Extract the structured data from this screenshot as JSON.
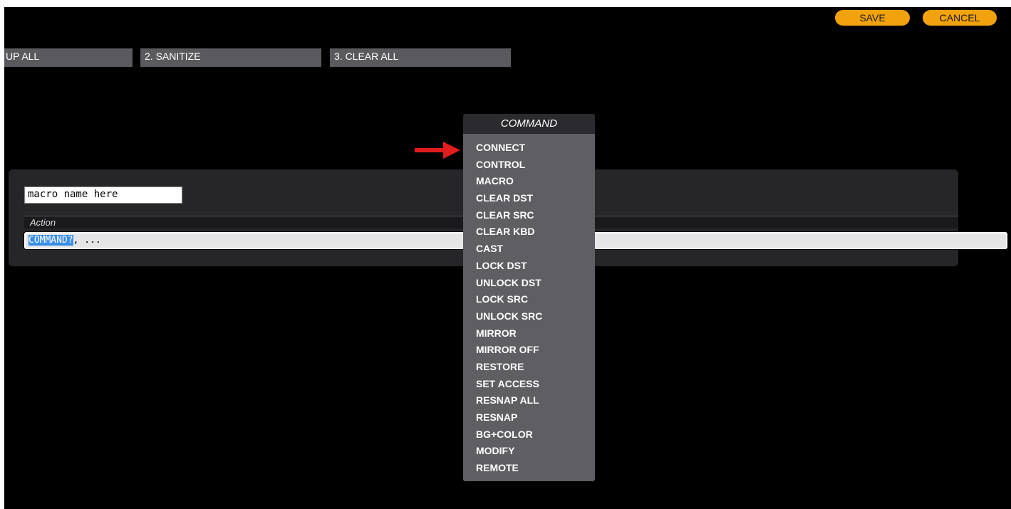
{
  "toolbar": {
    "save_label": "SAVE",
    "cancel_label": "CANCEL"
  },
  "colors": {
    "accent": "#f2a20c",
    "background": "#000000",
    "selection": "#3a8ee6",
    "annotation_arrow": "#e11d1d"
  },
  "macro_tabs": [
    {
      "label": "UP ALL"
    },
    {
      "label": "2. SANITIZE"
    },
    {
      "label": "3. CLEAR ALL"
    }
  ],
  "editor": {
    "name_value": "macro name here",
    "action_header": "Action",
    "action_selected": "COMMAND?",
    "action_rest": ", ..."
  },
  "command_menu": {
    "header": "COMMAND",
    "items": [
      "CONNECT",
      "CONTROL",
      "MACRO",
      "CLEAR DST",
      "CLEAR SRC",
      "CLEAR KBD",
      "CAST",
      "LOCK DST",
      "UNLOCK DST",
      "LOCK SRC",
      "UNLOCK SRC",
      "MIRROR",
      "MIRROR OFF",
      "RESTORE",
      "SET ACCESS",
      "RESNAP ALL",
      "RESNAP",
      "BG+COLOR",
      "MODIFY",
      "REMOTE"
    ]
  },
  "annotation": {
    "icon": "red-arrow-icon"
  }
}
